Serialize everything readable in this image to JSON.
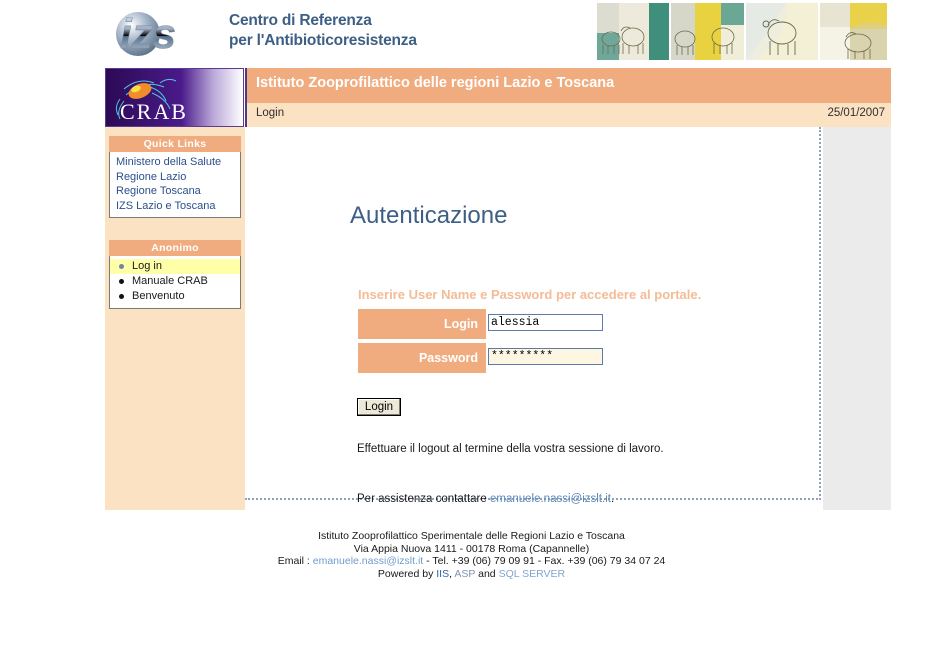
{
  "banner": {
    "logo_text": "izs",
    "logo_alt": "izs-logo",
    "title_line1": "Centro di Referenza",
    "title_line2": "per l'Antibioticoresistenza",
    "strip_alt": "sheep-artwork-strip"
  },
  "header": {
    "crab_logo_text": "CRAB",
    "site_title": "Istituto Zooprofilattico delle regioni Lazio e Toscana",
    "breadcrumb": "Login",
    "date": "25/01/2007"
  },
  "sidebar": {
    "quick_links": {
      "heading": "Quick Links",
      "items": [
        {
          "label": "Ministero della Salute"
        },
        {
          "label": "Regione Lazio"
        },
        {
          "label": "Regione Toscana"
        },
        {
          "label": "IZS Lazio e Toscana"
        }
      ]
    },
    "user_menu": {
      "heading": "Anonimo",
      "items": [
        {
          "label": "Log in",
          "active": true
        },
        {
          "label": "Manuale CRAB",
          "active": false
        },
        {
          "label": "Benvenuto",
          "active": false
        }
      ]
    }
  },
  "main": {
    "page_title": "Autenticazione",
    "intro": "Inserire User Name e Password per accedere al portale.",
    "form": {
      "login_label": "Login",
      "login_value": "alessia",
      "login_placeholder": "",
      "password_label": "Password",
      "password_value": "*********",
      "password_placeholder": "",
      "submit_label": "Login"
    },
    "note": "Effettuare il logout al termine della vostra sessione di lavoro.",
    "assistance_prefix": "Per assistenza contattare ",
    "assistance_email": "emanuele.nassi@izslt.it",
    "assistance_suffix": "."
  },
  "footer": {
    "line1": "Istituto Zooprofilattico Sperimentale delle Regioni Lazio e Toscana",
    "line2": "Via Appia Nuova 1411 - 00178 Roma (Capannelle)",
    "line3_prefix": "Email : ",
    "line3_email": "emanuele.nassi@izslt.it",
    "line3_suffix": " - Tel. +39 (06) 79 09 91 - Fax. +39 (06) 79 34 07 24",
    "line4_prefix": "Powered by ",
    "line4_iis": "IIS",
    "line4_sep1": ", ",
    "line4_asp": "ASP",
    "line4_sep2": " and ",
    "line4_sql": "SQL SERVER"
  },
  "colors": {
    "accent_salmon": "#f0ac7f",
    "cream": "#fae2c3",
    "link_blue": "#2b4f8e",
    "title_blue": "#3d5f86",
    "highlight_yellow": "#ffffa8",
    "dotted_border": "#8ea1bd"
  }
}
